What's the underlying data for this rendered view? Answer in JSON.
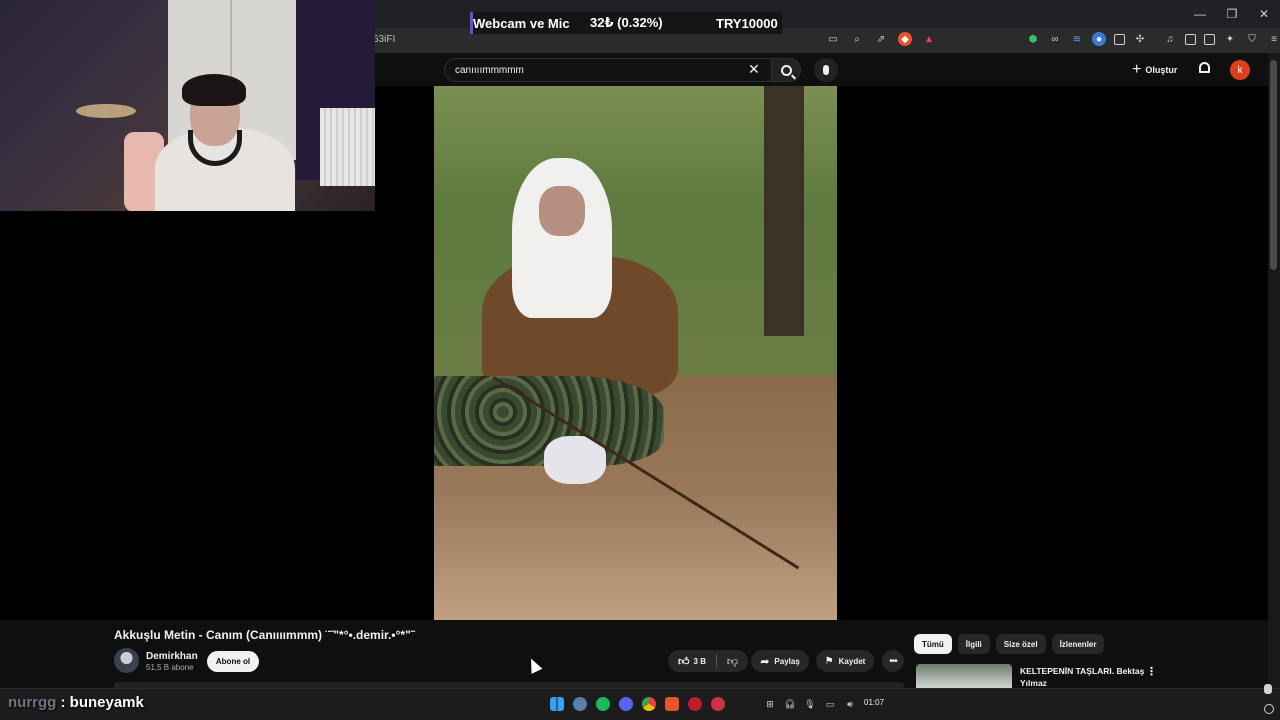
{
  "browser": {
    "url_fragment": "53iFI"
  },
  "stream_overlay": {
    "label": "Webcam ve Mic",
    "amount": "32₺ (0.32%)",
    "goal": "TRY10000"
  },
  "youtube": {
    "search_value": "canıııımmmmm",
    "create_label": "Oluştur",
    "avatar_letter": "k"
  },
  "video": {
    "title": "Akkuşlu Metin - Canım (Canıııımmm) ¨˜\"*°•.demir.•°*\"˜",
    "channel_name": "Demirkhan",
    "subscribers": "51,5 B abone",
    "subscribe_label": "Abone ol",
    "likes": "3 B",
    "share_label": "Paylaş",
    "save_label": "Kaydet"
  },
  "sidebar": {
    "chips": [
      {
        "label": "Tümü",
        "active": true
      },
      {
        "label": "İlgili",
        "active": false
      },
      {
        "label": "Size özel",
        "active": false
      },
      {
        "label": "İzlenenler",
        "active": false
      }
    ],
    "recommendation": {
      "title": "KELTEPENİN TAŞLARI. Bektaş Yılmaz"
    }
  },
  "chat": {
    "user": "nurrgg",
    "separator": ":",
    "message": "buneyamk"
  },
  "taskbar": {
    "time": "01:07"
  },
  "colors": {
    "background": "#0f0f0f",
    "accent_avatar": "#e03d1f",
    "chip_active": "#f1f1f1",
    "overlay_bar_accent": "#6b4ce0"
  }
}
